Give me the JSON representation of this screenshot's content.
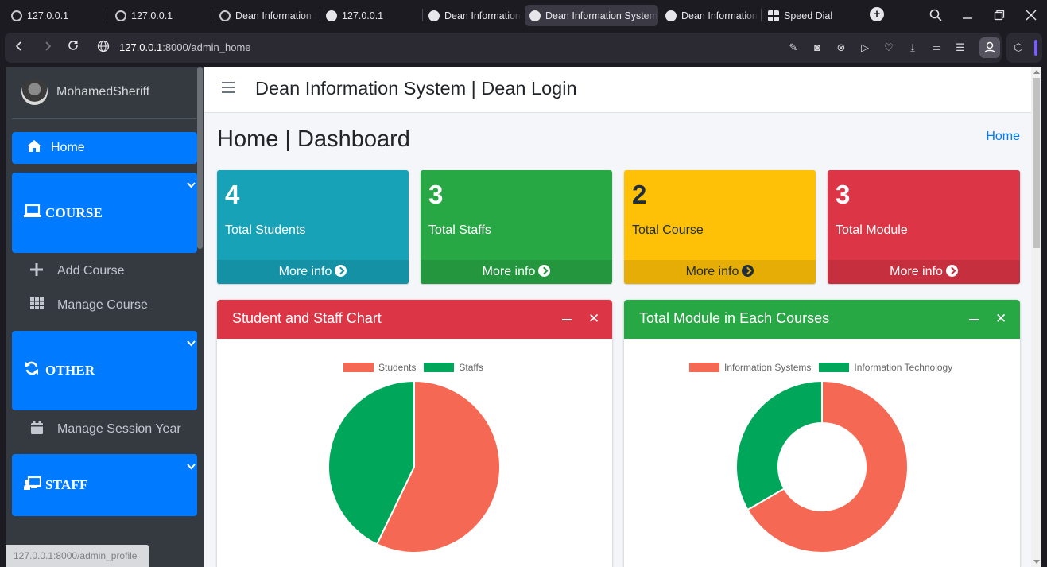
{
  "browser": {
    "tabs": [
      {
        "title": "127.0.0.1",
        "favicon": "loading-icon",
        "active": false
      },
      {
        "title": "127.0.0.1",
        "favicon": "loading-icon",
        "active": false
      },
      {
        "title": "Dean Information System",
        "favicon": "loading-icon",
        "active": false
      },
      {
        "title": "127.0.0.1",
        "favicon": "globe-icon",
        "active": false
      },
      {
        "title": "Dean Information System",
        "favicon": "globe-icon",
        "active": false
      },
      {
        "title": "Dean Information System",
        "favicon": "globe-icon",
        "active": true
      },
      {
        "title": "Dean Information System",
        "favicon": "globe-icon",
        "active": false
      },
      {
        "title": "Speed Dial",
        "favicon": "grid-icon",
        "active": false
      }
    ],
    "new_tab_symbol": "+",
    "url_host": "127.0.0.1",
    "url_rest": ":8000/admin_home",
    "status_url": "127.0.0.1:8000/admin_profile"
  },
  "sidebar": {
    "username": "MohamedSheriff",
    "home": {
      "label": "Home",
      "icon": "home-icon"
    },
    "groups": [
      {
        "label": "COURSE",
        "icon": "laptop-icon",
        "items": [
          {
            "label": "Add Course",
            "icon": "plus-icon"
          },
          {
            "label": "Manage Course",
            "icon": "grid-icon"
          }
        ]
      },
      {
        "label": "OTHER",
        "icon": "sync-icon",
        "items": [
          {
            "label": "Manage Session Year",
            "icon": "calendar-icon"
          }
        ]
      },
      {
        "label": "STAFF",
        "icon": "teacher-icon",
        "items": []
      }
    ],
    "colors": {
      "bg": "#343a40",
      "active": "#007bff",
      "text": "#c2c7d0"
    }
  },
  "header": {
    "title": "Dean Information System | Dean Login"
  },
  "page": {
    "title": "Home | Dashboard",
    "breadcrumb": "Home"
  },
  "stats": [
    {
      "value": "4",
      "label": "Total Students",
      "more": "More info",
      "color": "#17a2b8",
      "foot": "#1591a5",
      "text": "#ffffff"
    },
    {
      "value": "3",
      "label": "Total Staffs",
      "more": "More info",
      "color": "#28a745",
      "foot": "#24963e",
      "text": "#ffffff"
    },
    {
      "value": "2",
      "label": "Total Course",
      "more": "More info",
      "color": "#ffc107",
      "foot": "#e5ad06",
      "text": "#1f2d3d"
    },
    {
      "value": "3",
      "label": "Total Module",
      "more": "More info",
      "color": "#dc3545",
      "foot": "#c62f3e",
      "text": "#ffffff"
    }
  ],
  "cards": [
    {
      "title": "Student and Staff Chart",
      "color": "#dc3545"
    },
    {
      "title": "Total Module in Each Courses",
      "color": "#28a745"
    }
  ],
  "chart_data": [
    {
      "type": "pie",
      "title": "Student and Staff Chart",
      "categories": [
        "Students",
        "Staffs"
      ],
      "values": [
        4,
        3
      ],
      "colors": [
        "#f56954",
        "#00a65a"
      ],
      "legend": "top"
    },
    {
      "type": "pie",
      "variant": "doughnut",
      "title": "Total Module in Each Courses",
      "categories": [
        "Information Systems",
        "Information Technology"
      ],
      "values": [
        2,
        1
      ],
      "colors": [
        "#f56954",
        "#00a65a"
      ],
      "legend": "top"
    }
  ]
}
